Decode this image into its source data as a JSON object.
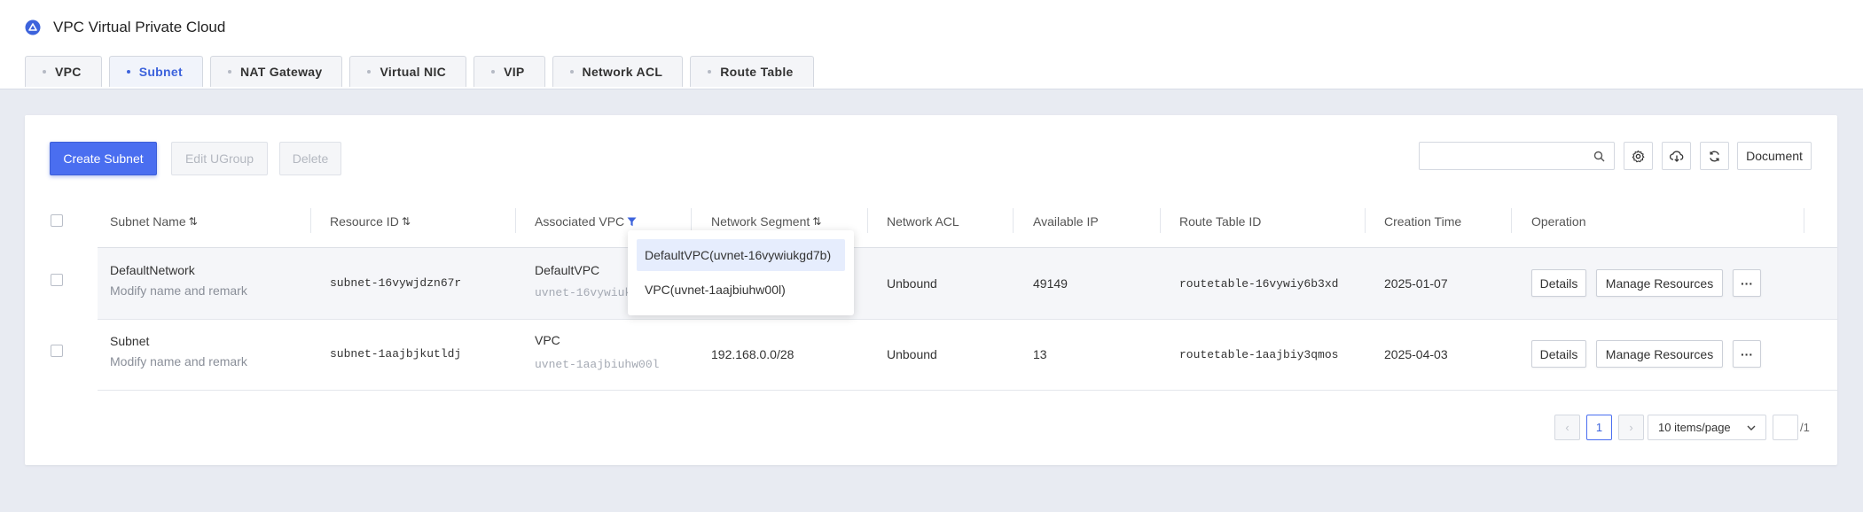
{
  "app": {
    "title": "VPC Virtual Private Cloud"
  },
  "tabs": [
    {
      "label": "VPC",
      "active": false
    },
    {
      "label": "Subnet",
      "active": true
    },
    {
      "label": "NAT Gateway",
      "active": false
    },
    {
      "label": "Virtual NIC",
      "active": false
    },
    {
      "label": "VIP",
      "active": false
    },
    {
      "label": "Network ACL",
      "active": false
    },
    {
      "label": "Route Table",
      "active": false
    }
  ],
  "toolbar": {
    "create_label": "Create Subnet",
    "edit_ugroup_label": "Edit UGroup",
    "delete_label": "Delete",
    "search_placeholder": "",
    "document_label": "Document"
  },
  "table": {
    "columns": {
      "name": "Subnet Name",
      "resource_id": "Resource ID",
      "vpc": "Associated VPC",
      "segment": "Network Segment",
      "acl": "Network ACL",
      "available_ip": "Available IP",
      "route_table": "Route Table ID",
      "created": "Creation Time",
      "operation": "Operation"
    },
    "rows": [
      {
        "name": "DefaultNetwork",
        "remark": "Modify name and remark",
        "resource_id": "subnet-16vywjdzn67r",
        "vpc_name": "DefaultVPC",
        "vpc_id": "uvnet-16vywiukgd7b",
        "segment": "",
        "acl": "Unbound",
        "available_ip": "49149",
        "route_table": "routetable-16vywiy6b3xd",
        "created": "2025-01-07"
      },
      {
        "name": "Subnet",
        "remark": "Modify name and remark",
        "resource_id": "subnet-1aajbjkutldj",
        "vpc_name": "VPC",
        "vpc_id": "uvnet-1aajbiuhw00l",
        "segment": "192.168.0.0/28",
        "acl": "Unbound",
        "available_ip": "13",
        "route_table": "routetable-1aajbiy3qmos",
        "created": "2025-04-03"
      }
    ],
    "row_actions": {
      "details": "Details",
      "manage": "Manage Resources",
      "more": "···"
    }
  },
  "vpc_filter_dropdown": {
    "options": [
      {
        "label": "DefaultVPC(uvnet-16vywiukgd7b)",
        "selected": true
      },
      {
        "label": "VPC(uvnet-1aajbiuhw00l)",
        "selected": false
      }
    ]
  },
  "pagination": {
    "prev": "‹",
    "current_page": "1",
    "next": "›",
    "page_size": "10 items/page",
    "jump_value": "",
    "total_pages": "/1"
  },
  "colors": {
    "accent": "#4a6ef0",
    "background": "#e8ebf2"
  }
}
